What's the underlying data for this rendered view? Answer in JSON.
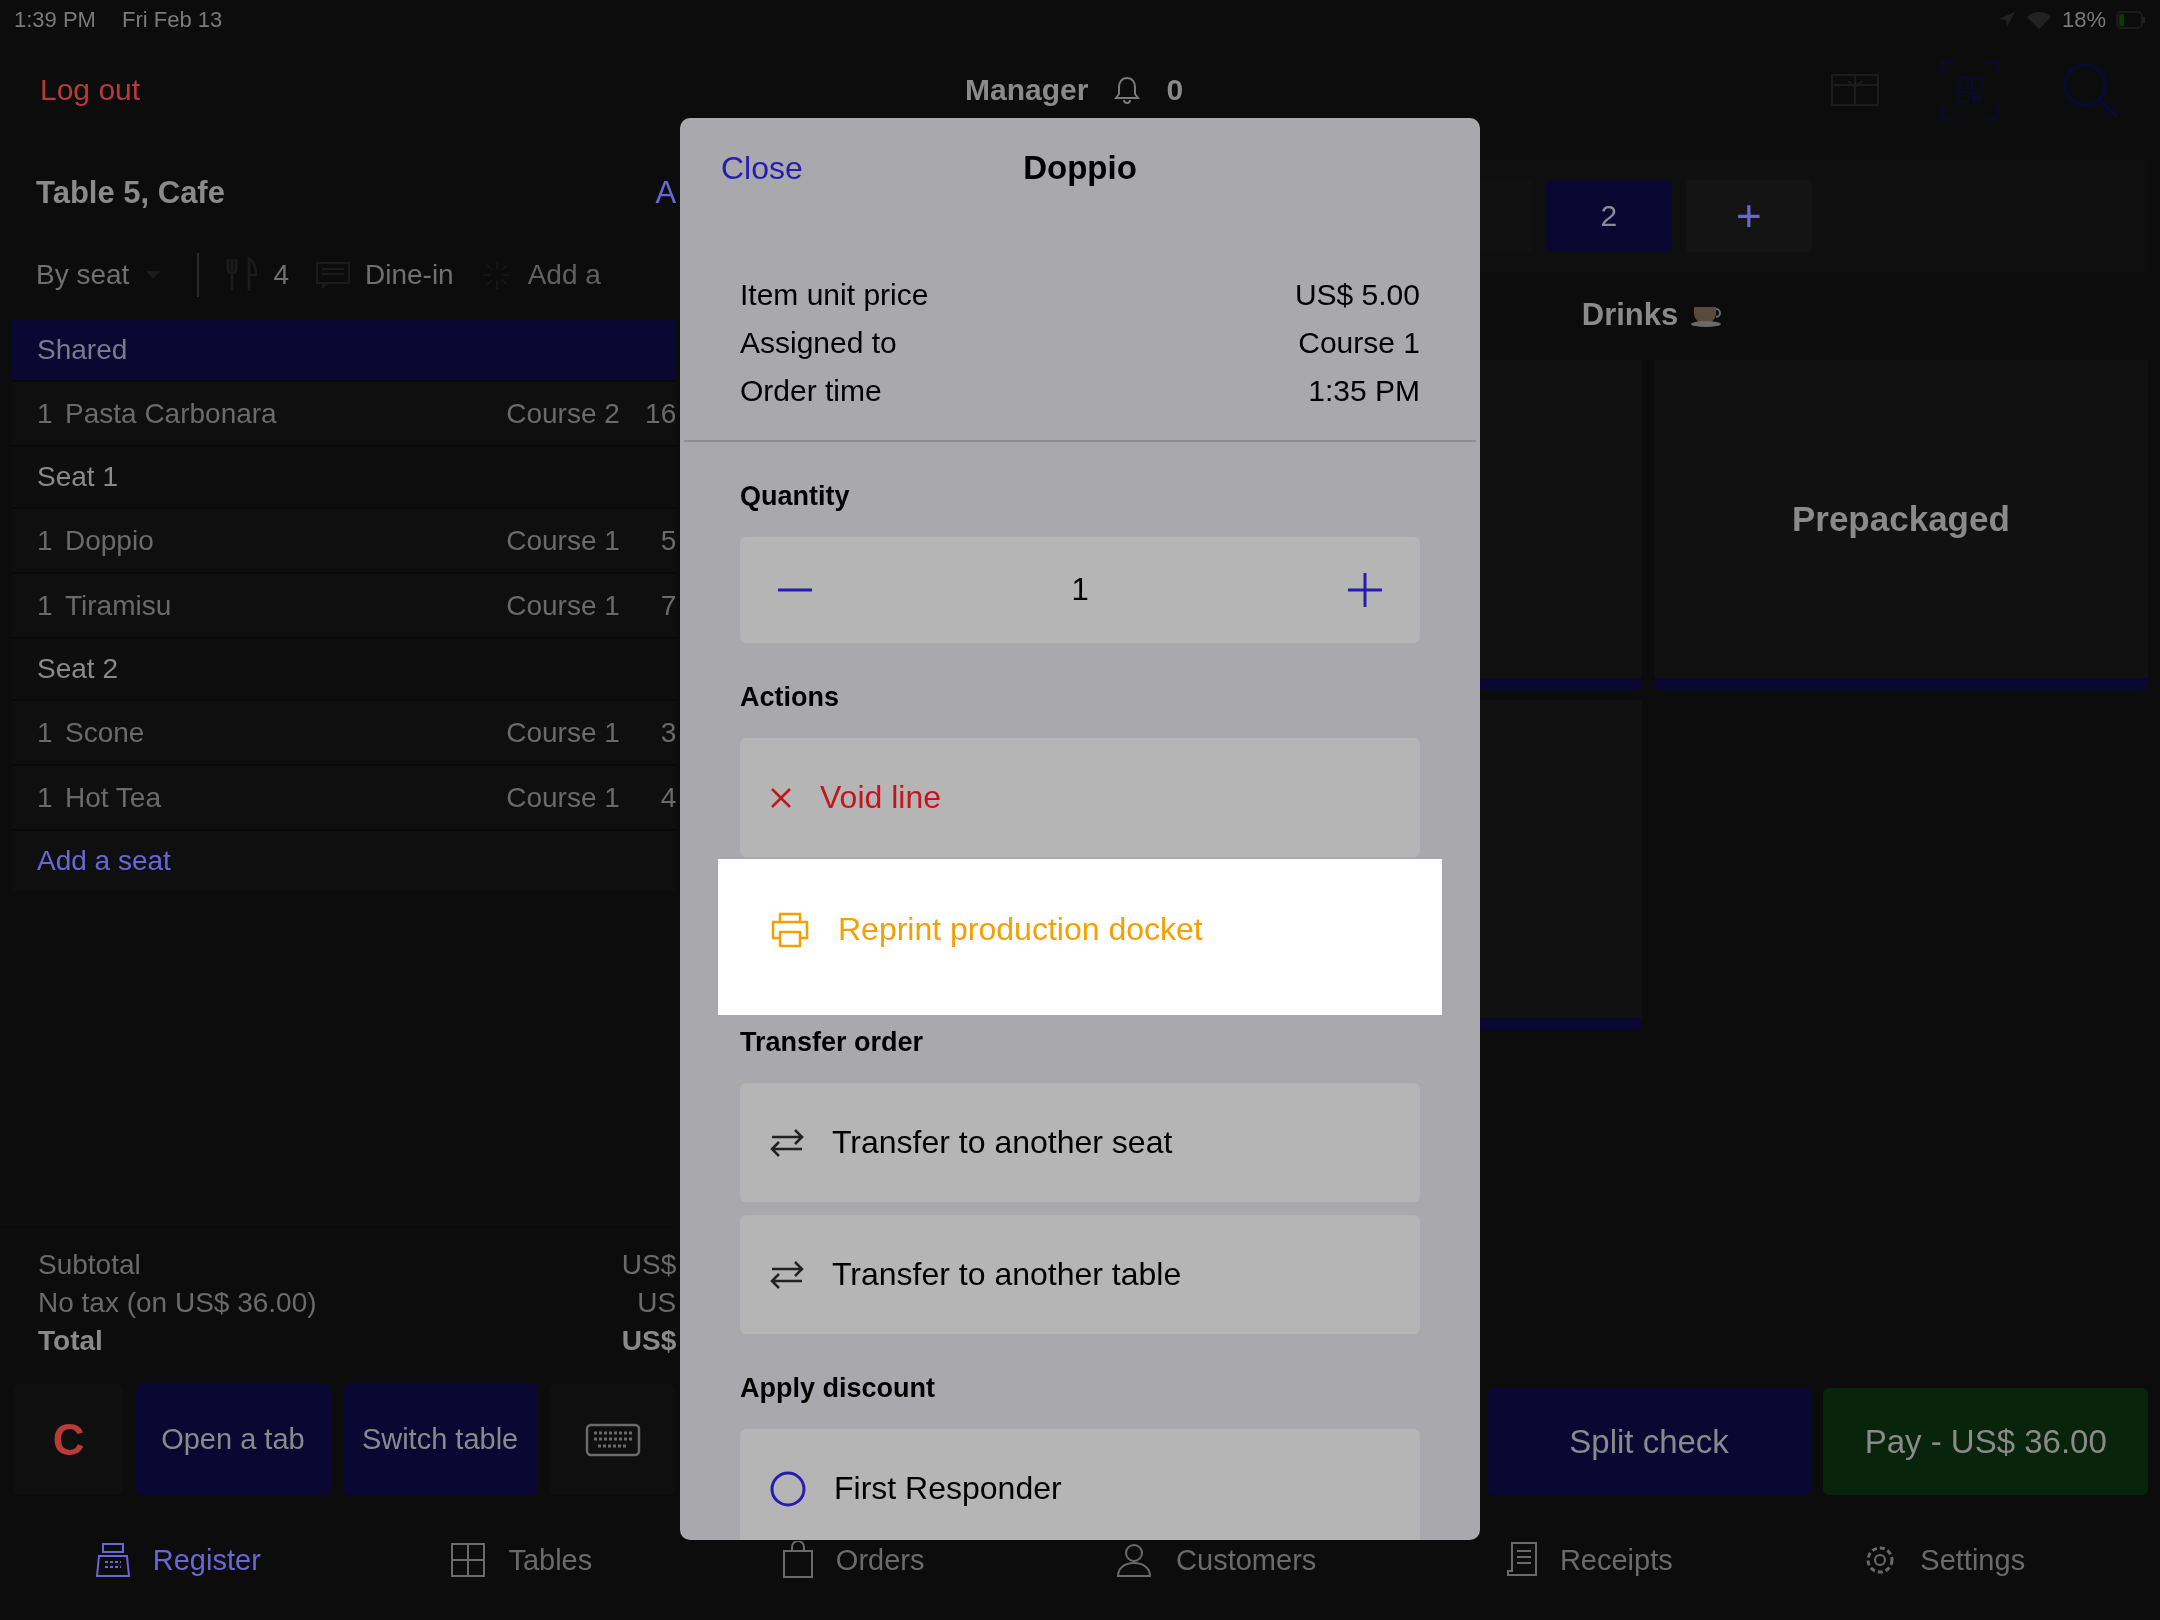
{
  "status_bar": {
    "time": "1:39 PM",
    "date": "Fri Feb 13",
    "battery": "18%"
  },
  "nav": {
    "logout": "Log out",
    "title": "Manager",
    "notifications": "0"
  },
  "order": {
    "title": "Table 5, Cafe",
    "title_link": "A",
    "view_mode": "By seat",
    "guests": "4",
    "dining": "Dine-in",
    "add_label": "Add a",
    "groups": [
      {
        "name": "Shared",
        "selected": true,
        "items": [
          {
            "qty": "1",
            "name": "Pasta Carbonara",
            "course": "Course 2",
            "price": "16"
          }
        ]
      },
      {
        "name": "Seat 1",
        "selected": false,
        "items": [
          {
            "qty": "1",
            "name": "Doppio",
            "course": "Course 1",
            "price": "5"
          },
          {
            "qty": "1",
            "name": "Tiramisu",
            "course": "Course 1",
            "price": "7"
          }
        ]
      },
      {
        "name": "Seat 2",
        "selected": false,
        "items": [
          {
            "qty": "1",
            "name": "Scone",
            "course": "Course 1",
            "price": "3"
          },
          {
            "qty": "1",
            "name": "Hot Tea",
            "course": "Course 1",
            "price": "4"
          }
        ]
      }
    ],
    "add_seat": "Add a seat",
    "totals": [
      {
        "label": "Subtotal",
        "value": "US$",
        "kind": "normal"
      },
      {
        "label": "No tax (on US$ 36.00)",
        "value": "US",
        "kind": "normal"
      },
      {
        "label": "Total",
        "value": "US$",
        "kind": "total"
      }
    ],
    "clear": "C",
    "buttons": [
      "Open a tab",
      "Switch table"
    ]
  },
  "menu": {
    "seat_tabs": [
      {
        "label": "2",
        "selected": true
      }
    ],
    "add_tab": "+",
    "category": "Drinks",
    "tiles": [
      {
        "label": "Prepackaged"
      }
    ],
    "actions": [
      {
        "label": "Split check",
        "kind": "split"
      },
      {
        "label": "Pay - US$ 36.00",
        "kind": "pay"
      }
    ]
  },
  "tab_bar": [
    {
      "label": "Register",
      "selected": true,
      "kind": "register"
    },
    {
      "label": "Tables",
      "selected": false,
      "kind": "tables"
    },
    {
      "label": "Orders",
      "selected": false,
      "kind": "orders"
    },
    {
      "label": "Customers",
      "selected": false,
      "kind": "customers"
    },
    {
      "label": "Receipts",
      "selected": false,
      "kind": "receipts"
    },
    {
      "label": "Settings",
      "selected": false,
      "kind": "settings"
    }
  ],
  "dialog": {
    "close": "Close",
    "title": "Doppio",
    "details": [
      {
        "label": "Item unit price",
        "value": "US$ 5.00"
      },
      {
        "label": "Assigned to",
        "value": "Course 1"
      },
      {
        "label": "Order time",
        "value": "1:35 PM"
      }
    ],
    "quantity_label": "Quantity",
    "quantity": "1",
    "sections": [
      {
        "title": "Actions",
        "items": [
          {
            "kind": "void",
            "label": "Void line",
            "highlighted": false
          },
          {
            "kind": "reprint",
            "label": "Reprint production docket",
            "highlighted": true
          }
        ]
      },
      {
        "title": "Transfer order",
        "items": [
          {
            "kind": "transfer",
            "label": "Transfer to another seat",
            "highlighted": false
          },
          {
            "kind": "transfer",
            "label": "Transfer to another table",
            "highlighted": false
          }
        ]
      },
      {
        "title": "Apply discount",
        "items": [
          {
            "kind": "discount",
            "label": "First Responder",
            "highlighted": false,
            "selected": false
          }
        ]
      }
    ]
  }
}
